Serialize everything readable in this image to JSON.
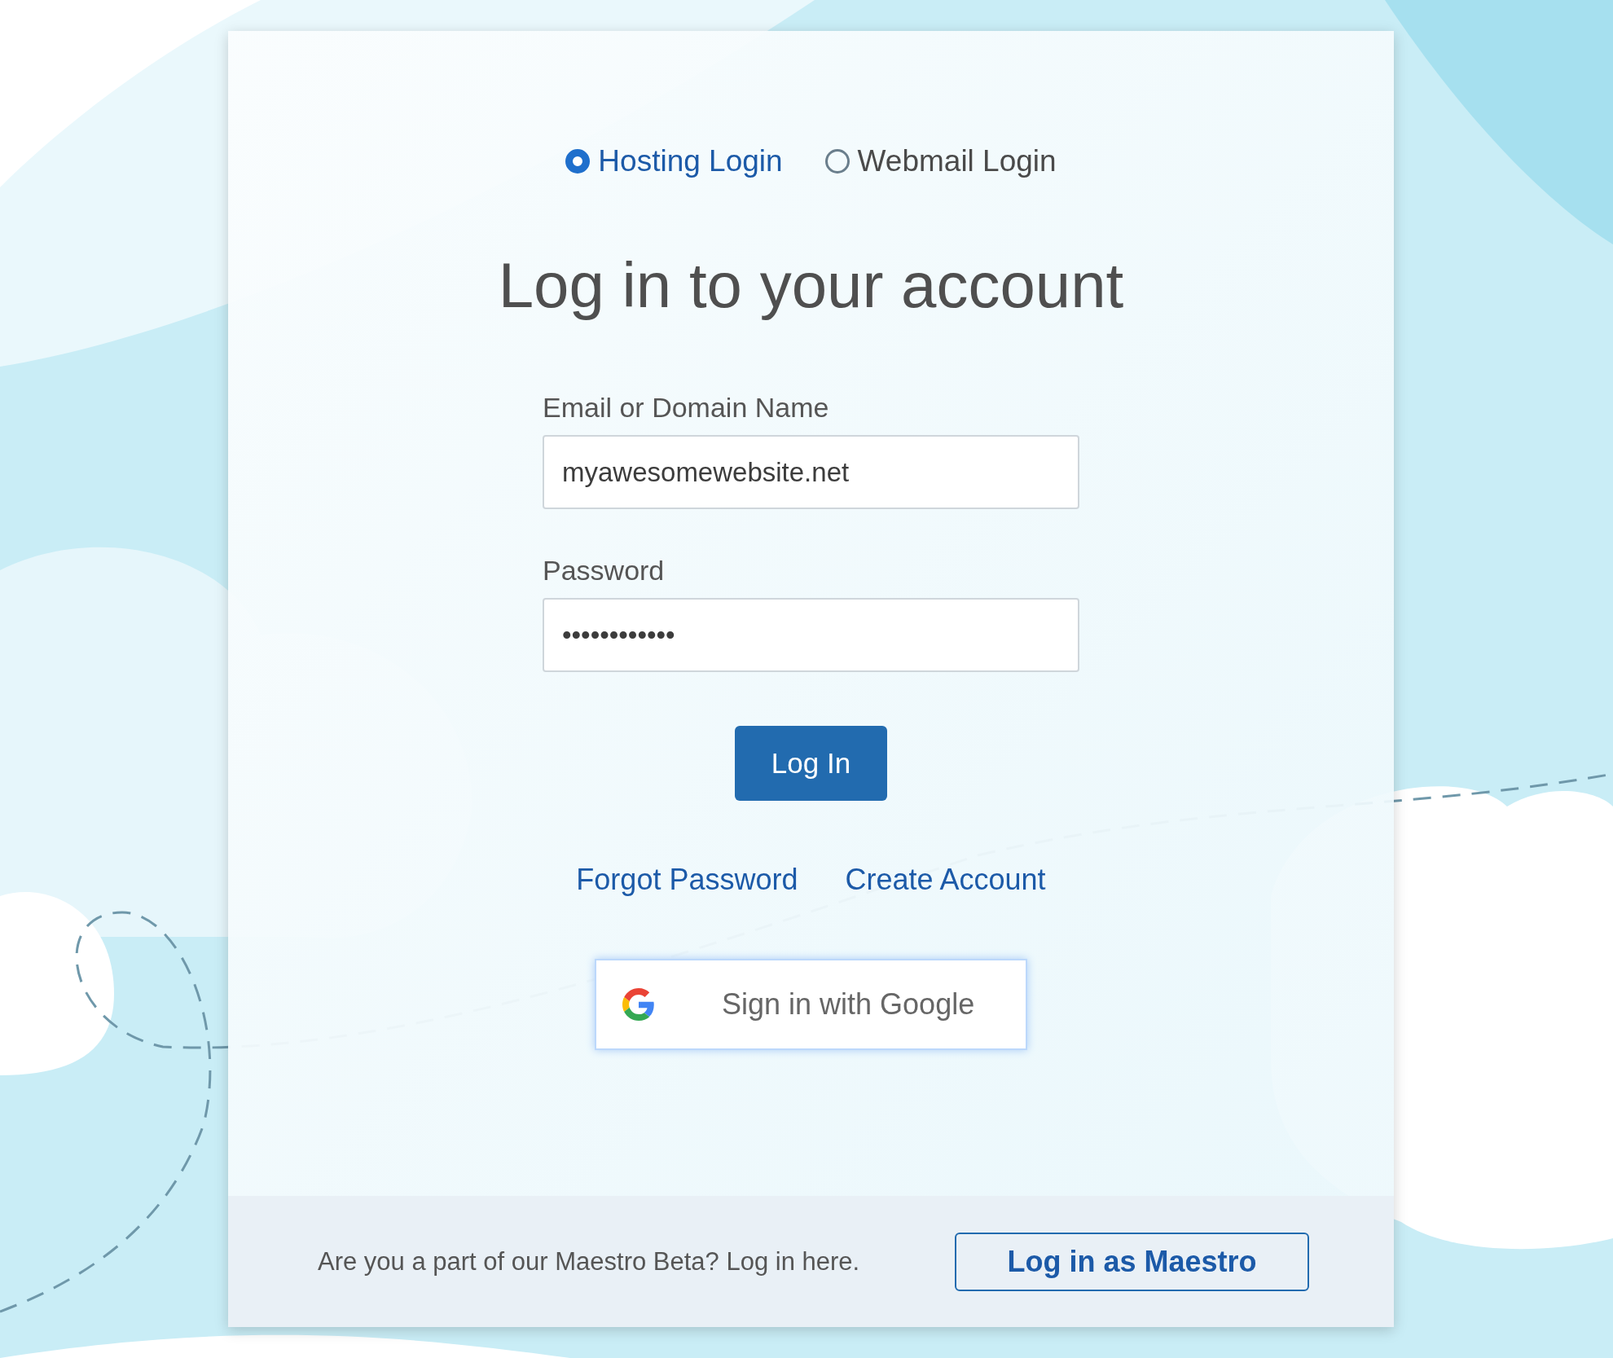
{
  "login_types": [
    {
      "label": "Hosting Login",
      "selected": true
    },
    {
      "label": "Webmail Login",
      "selected": false
    }
  ],
  "title": "Log in to your account",
  "fields": [
    {
      "label": "Email or Domain Name",
      "value": "myawesomewebsite.net"
    },
    {
      "label": "Password",
      "value": "••••••••••••"
    }
  ],
  "login_button": "Log In",
  "links": [
    "Forgot Password",
    "Create Account"
  ],
  "google_button": "Sign in with Google",
  "footer": {
    "text": "Are you a part of our Maestro Beta? Log in here.",
    "button": "Log in as Maestro"
  }
}
